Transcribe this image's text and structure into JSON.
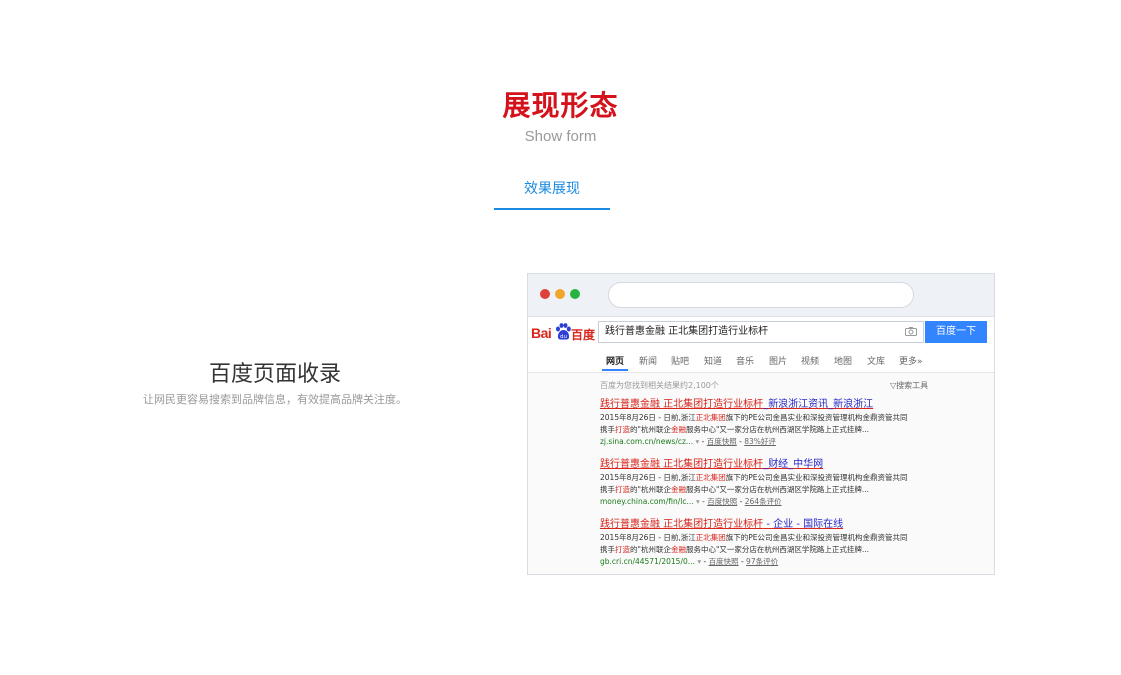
{
  "header": {
    "title": "展现形态",
    "subtitle": "Show form",
    "tab_label": "效果展现"
  },
  "feature": {
    "title": "百度页面收录",
    "description": "让网民更容易搜索到品牌信息，有效提高品牌关注度。"
  },
  "browser": {
    "logo_left": "Bai",
    "logo_right": "百度",
    "search_query": "践行普惠金融 正北集团打造行业标杆",
    "search_button": "百度一下",
    "nav": [
      "网页",
      "新闻",
      "贴吧",
      "知道",
      "音乐",
      "图片",
      "视频",
      "地图",
      "文库",
      "更多»"
    ],
    "stat_text": "百度为您找到相关结果约2,100个",
    "tools_text": "▽搜索工具",
    "results": [
      {
        "title_red": "践行普惠金融 正北集团打造行业标杆",
        "title_blue": "_新浪浙江资讯_新浪浙江",
        "line1_a": "2015年8月26日 - 日前,浙江",
        "line1_hl": "正北集团",
        "line1_b": "旗下的PE公司金昌实业和深投资管理机构金鼎资管共同",
        "line2_a": "携手",
        "line2_hl1": "打造",
        "line2_b": "的\"杭州联企",
        "line2_hl2": "金融",
        "line2_c": "服务中心\"又一家分店在杭州西湖区学院路上正式挂牌...",
        "url": "zj.sina.com.cn/news/cz...",
        "snapshot": "百度快照",
        "extra": "83%好评"
      },
      {
        "title_red": "践行普惠金融 正北集团打造行业标杆",
        "title_blue": "_财经_中华网",
        "line1_a": "2015年8月26日 - 日前,浙江",
        "line1_hl": "正北集团",
        "line1_b": "旗下的PE公司金昌实业和深投资管理机构金鼎资管共同",
        "line2_a": "携手",
        "line2_hl1": "打造",
        "line2_b": "的\"杭州联企",
        "line2_hl2": "金融",
        "line2_c": "服务中心\"又一家分店在杭州西湖区学院路上正式挂牌...",
        "url": "money.china.com/fin/lc...",
        "snapshot": "百度快照",
        "extra": "264条评价"
      },
      {
        "title_red": "践行普惠金融 正北集团打造行业标杆",
        "title_blue": " - 企业 - 国际在线",
        "line1_a": "2015年8月26日 - 日前,浙江",
        "line1_hl": "正北集团",
        "line1_b": "旗下的PE公司金昌实业和深投资管理机构金鼎资管共同",
        "line2_a": "携手",
        "line2_hl1": "打造",
        "line2_b": "的\"杭州联企",
        "line2_hl2": "金融",
        "line2_c": "服务中心\"又一家分店在杭州西湖区学院路上正式挂牌...",
        "url": "gb.cri.cn/44571/2015/0...",
        "snapshot": "百度快照",
        "extra": "97条评价"
      }
    ]
  },
  "colors": {
    "title_red": "#d4121b",
    "tab_blue": "#1a8be0",
    "search_button": "#3385ff",
    "result_link": "#d9251d",
    "result_url": "#1a7a1a"
  }
}
